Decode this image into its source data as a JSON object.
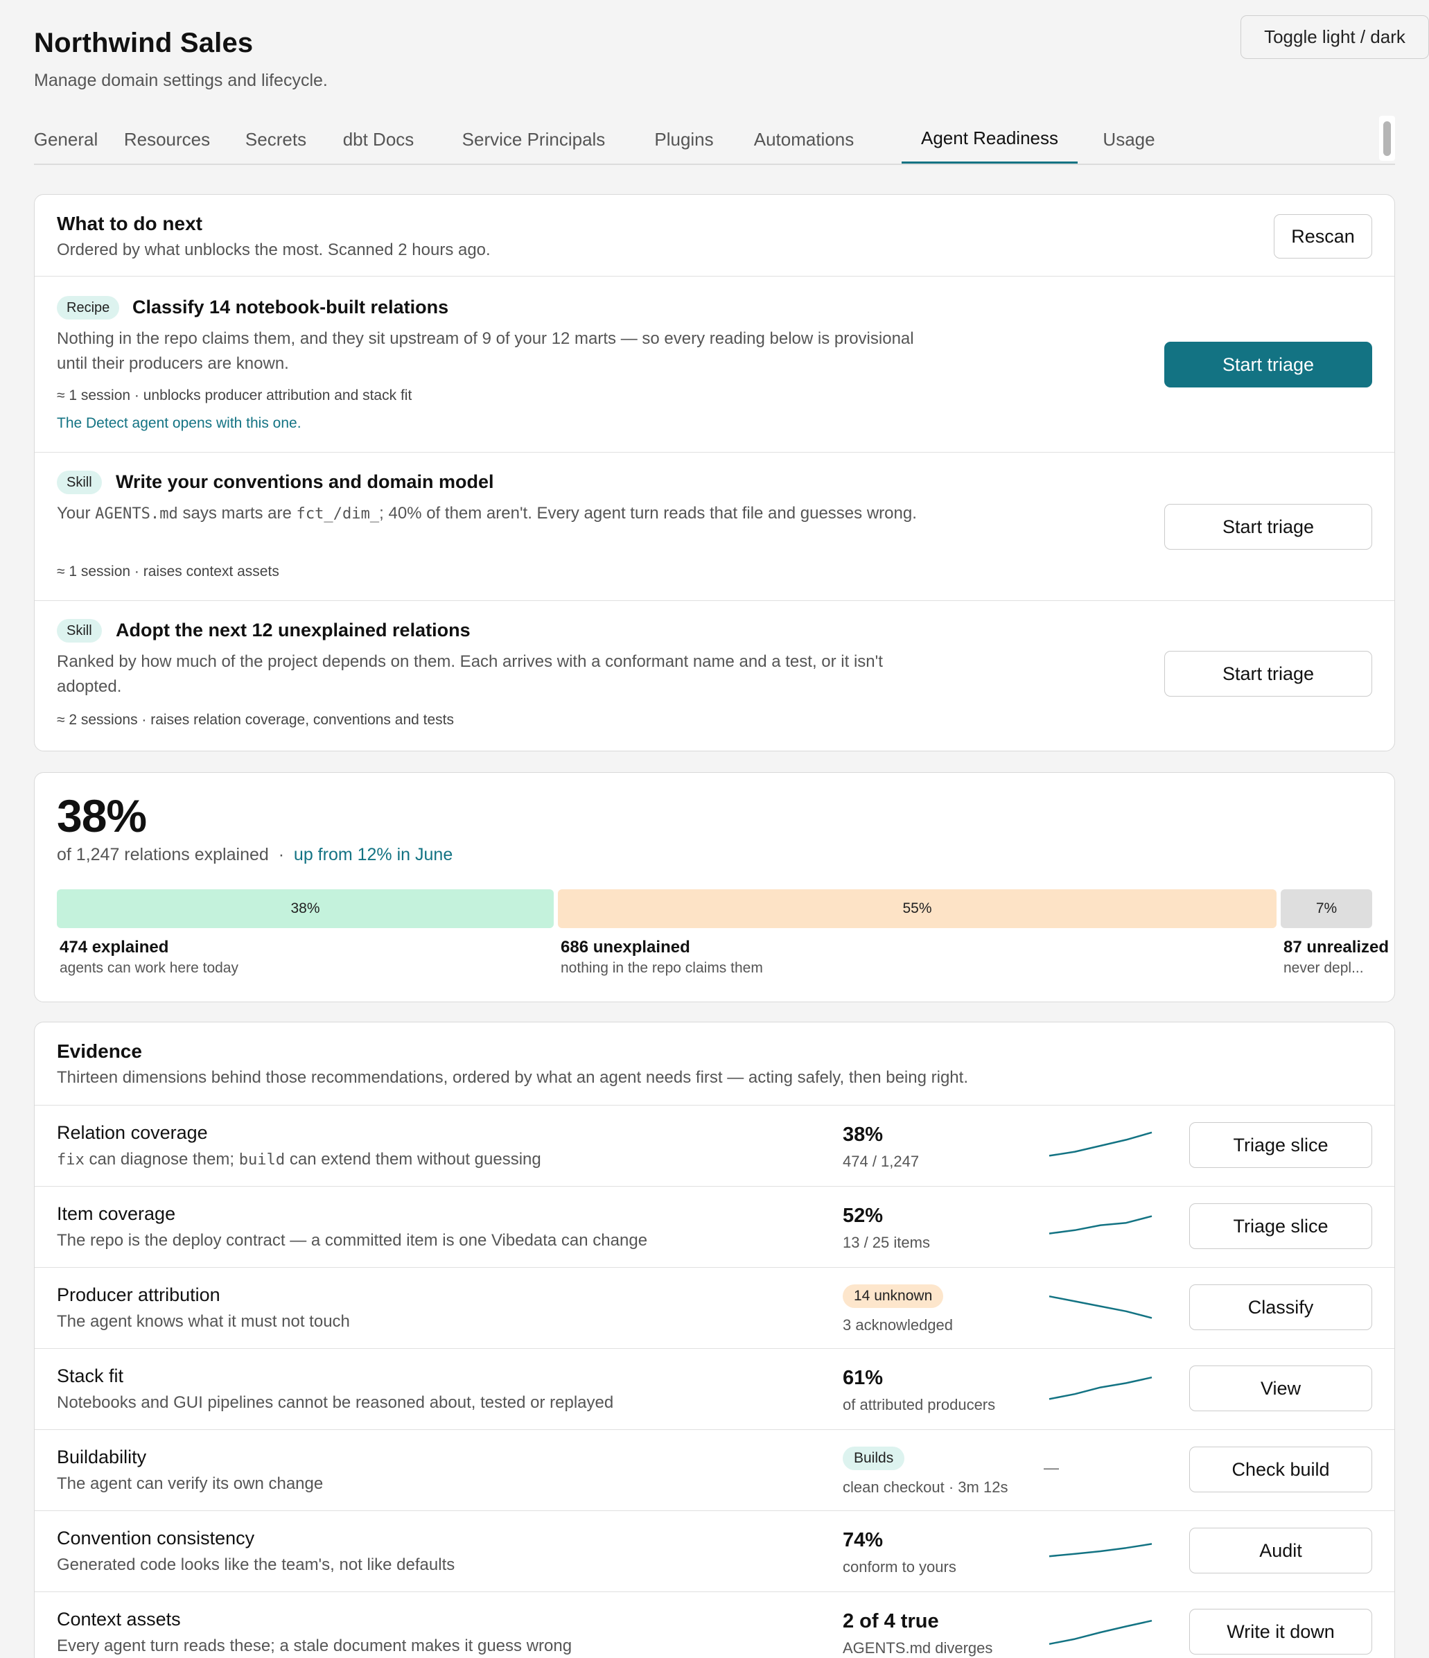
{
  "header": {
    "title": "Northwind Sales",
    "subtitle": "Manage domain settings and lifecycle.",
    "toggle_label": "Toggle light / dark"
  },
  "tabs": [
    {
      "label": "General"
    },
    {
      "label": "Resources"
    },
    {
      "label": "Secrets"
    },
    {
      "label": "dbt Docs"
    },
    {
      "label": "Service Principals"
    },
    {
      "label": "Plugins"
    },
    {
      "label": "Automations"
    },
    {
      "label": "Agent Readiness",
      "active": true
    },
    {
      "label": "Usage"
    }
  ],
  "next": {
    "title": "What to do next",
    "subtitle": "Ordered by what unblocks the most. Scanned 2 hours ago.",
    "rescan_label": "Rescan",
    "items": [
      {
        "badge": "Recipe",
        "title": "Classify 14 notebook-built relations",
        "desc": "Nothing in the repo claims them, and they sit upstream of 9 of your 12 marts — so every reading below is provisional until their producers are known.",
        "meta": "≈ 1 session · unblocks producer attribution and stack fit",
        "note": "The Detect agent opens with this one.",
        "button": "Start triage"
      },
      {
        "badge": "Skill",
        "title": "Write your conventions and domain model",
        "desc_pre": "Your ",
        "desc_code1": "AGENTS.md",
        "desc_mid": " says marts are ",
        "desc_code2": "fct_/dim_",
        "desc_post": "; 40% of them aren't. Every agent turn reads that file and guesses wrong.",
        "meta": "≈ 1 session · raises context assets",
        "button": "Start triage"
      },
      {
        "badge": "Skill",
        "title": "Adopt the next 12 unexplained relations",
        "desc": "Ranked by how much of the project depends on them. Each arrives with a conformant name and a test, or it isn't adopted.",
        "meta": "≈ 2 sessions · raises relation coverage, conventions and tests",
        "button": "Start triage"
      }
    ]
  },
  "stats": {
    "big": "38%",
    "sub": "of 1,247 relations explained",
    "sep": "·",
    "trend": "up from 12% in June",
    "segments": [
      {
        "pct_label": "38%",
        "fraction": 0.38,
        "color": "#c4f2dc",
        "label": "474 explained",
        "desc": "agents can work here today"
      },
      {
        "pct_label": "55%",
        "fraction": 0.55,
        "color": "#fde3c6",
        "label": "686 unexplained",
        "desc": "nothing in the repo claims them"
      },
      {
        "pct_label": "7%",
        "fraction": 0.07,
        "color": "#dedede",
        "label": "87 unrealized",
        "desc": "never depl..."
      }
    ]
  },
  "evidence": {
    "title": "Evidence",
    "subtitle": "Thirteen dimensions behind those recommendations, ordered by what an agent needs first — acting safely, then being right.",
    "rows": [
      {
        "name": "Relation coverage",
        "desc_code1": "fix",
        "desc_mid": " can diagnose them; ",
        "desc_code2": "build",
        "desc_post": " can extend them without guessing",
        "value": "38%",
        "detail": "474 / 1,247",
        "trend": [
          0.2,
          0.32,
          0.5,
          0.68,
          0.9
        ],
        "button": "Triage slice"
      },
      {
        "name": "Item coverage",
        "desc": "The repo is the deploy contract — a committed item is one Vibedata can change",
        "value": "52%",
        "detail": "13 / 25 items",
        "trend": [
          0.3,
          0.4,
          0.55,
          0.62,
          0.82
        ],
        "button": "Triage slice"
      },
      {
        "name": "Producer attribution",
        "desc": "The agent knows what it must not touch",
        "pill": "14 unknown",
        "pill_color": "#fde6cc",
        "detail": "3 acknowledged",
        "trend": [
          0.85,
          0.7,
          0.55,
          0.4,
          0.2
        ],
        "button": "Classify"
      },
      {
        "name": "Stack fit",
        "desc": "Notebooks and GUI pipelines cannot be reasoned about, tested or replayed",
        "value": "61%",
        "detail": "of attributed producers",
        "trend": [
          0.2,
          0.35,
          0.55,
          0.68,
          0.85
        ],
        "button": "View"
      },
      {
        "name": "Buildability",
        "desc": "The agent can verify its own change",
        "pill": "Builds",
        "pill_color": "#ddf3ef",
        "detail": "clean checkout · 3m 12s",
        "dash": "—",
        "button": "Check build"
      },
      {
        "name": "Convention consistency",
        "desc": "Generated code looks like the team's, not like defaults",
        "value": "74%",
        "detail": "conform to yours",
        "trend": [
          0.35,
          0.42,
          0.5,
          0.6,
          0.72
        ],
        "button": "Audit"
      },
      {
        "name": "Context assets",
        "desc": "Every agent turn reads these; a stale document makes it guess wrong",
        "value": "2 of 4 true",
        "detail": "AGENTS.md diverges",
        "trend": [
          0.15,
          0.3,
          0.5,
          0.68,
          0.85
        ],
        "button": "Write it down"
      }
    ]
  }
}
